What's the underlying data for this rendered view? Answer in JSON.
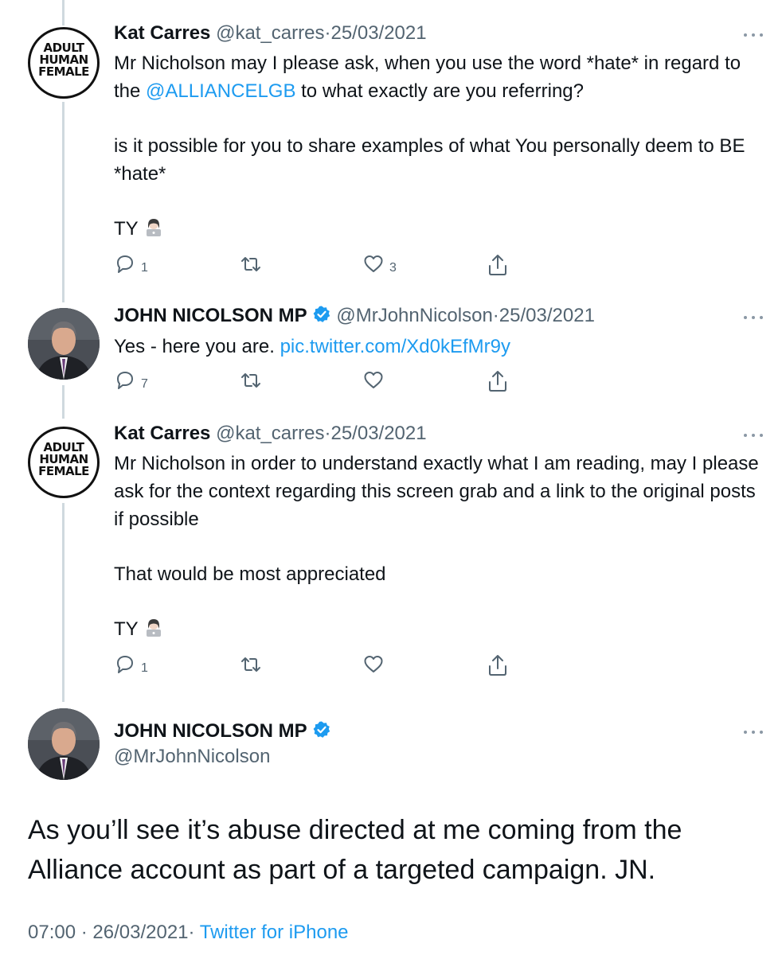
{
  "tweets": [
    {
      "name": "Kat Carres",
      "handle": "@kat_carres",
      "date": "25/03/2021",
      "avatar_text": [
        "ADULT",
        "HUMAN",
        "FEMALE"
      ],
      "text_before_link": "Mr Nicholson may I please ask, when you use the word *hate* in regard to the ",
      "link": "@ALLIANCELGB",
      "text_after_link": " to what exactly are you referring?",
      "para2": "is it possible for you to share examples of what You personally deem to BE *hate*",
      "para3": "TY",
      "replies": "1",
      "likes": "3"
    },
    {
      "name": "JOHN NICOLSON MP",
      "handle": "@MrJohnNicolson",
      "date": "25/03/2021",
      "text": "Yes - here you are. ",
      "link": "pic.twitter.com/Xd0kEfMr9y",
      "replies": "7"
    },
    {
      "name": "Kat Carres",
      "handle": "@kat_carres",
      "date": "25/03/2021",
      "avatar_text": [
        "ADULT",
        "HUMAN",
        "FEMALE"
      ],
      "para1": "Mr Nicholson in order to understand exactly what I am reading, may I please ask for the context regarding this screen grab and a link to the original posts if possible",
      "para2": "That would be most appreciated",
      "para3": "TY",
      "replies": "1"
    }
  ],
  "main_tweet": {
    "name": "JOHN NICOLSON MP",
    "handle": "@MrJohnNicolson",
    "text": "As you’ll see it’s abuse directed at me coming from the Alliance account as part of a targeted campaign. JN.",
    "time": "07:00",
    "date": "26/03/2021",
    "source": "Twitter for iPhone"
  },
  "separator": "·",
  "colors": {
    "link": "#1d9bf0",
    "secondary_text": "#536471",
    "verified": "#1d9bf0",
    "thread_line": "#cfd9de"
  },
  "icons": [
    "reply-icon",
    "retweet-icon",
    "like-icon",
    "share-icon",
    "verified-badge-icon",
    "more-options-icon",
    "technologist-emoji"
  ]
}
